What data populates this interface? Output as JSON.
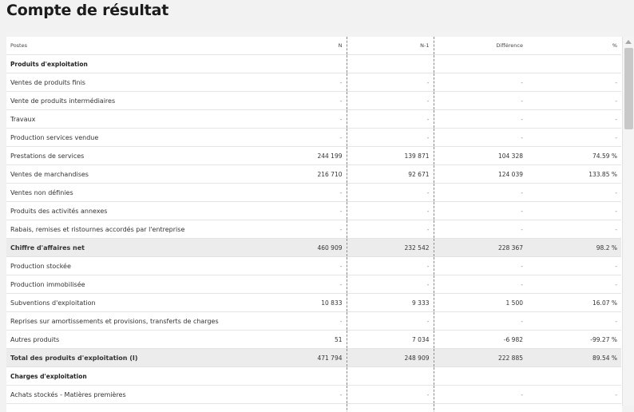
{
  "page": {
    "title": "Compte de résultat"
  },
  "table": {
    "headers": {
      "label": "Postes",
      "n": "N",
      "n1": "N-1",
      "diff": "Différence",
      "pct": "%"
    },
    "rows": [
      {
        "kind": "section",
        "label": "Produits d'exploitation",
        "n": "",
        "n1": "",
        "diff": "",
        "pct": ""
      },
      {
        "kind": "data",
        "label": "Ventes de produits finis",
        "n": "-",
        "n1": "-",
        "diff": "-",
        "pct": "-"
      },
      {
        "kind": "data",
        "label": "Vente de produits intermédiaires",
        "n": "-",
        "n1": "-",
        "diff": "-",
        "pct": "-"
      },
      {
        "kind": "data",
        "label": "Travaux",
        "n": "-",
        "n1": "-",
        "diff": "-",
        "pct": "-"
      },
      {
        "kind": "data",
        "label": "Production services vendue",
        "n": "-",
        "n1": "-",
        "diff": "-",
        "pct": "-"
      },
      {
        "kind": "data",
        "label": "Prestations de services",
        "n": "244 199",
        "n1": "139 871",
        "diff": "104 328",
        "pct": "74.59 %"
      },
      {
        "kind": "data",
        "label": "Ventes de marchandises",
        "n": "216 710",
        "n1": "92 671",
        "diff": "124 039",
        "pct": "133.85 %"
      },
      {
        "kind": "data",
        "label": "Ventes non définies",
        "n": "-",
        "n1": "-",
        "diff": "-",
        "pct": "-"
      },
      {
        "kind": "data",
        "label": "Produits des activités annexes",
        "n": "-",
        "n1": "-",
        "diff": "-",
        "pct": "-"
      },
      {
        "kind": "data",
        "label": "Rabais, remises et ristournes accordés par l'entreprise",
        "n": "-",
        "n1": "-",
        "diff": "-",
        "pct": "-"
      },
      {
        "kind": "total",
        "label": "Chiffre d'affaires net",
        "n": "460 909",
        "n1": "232 542",
        "diff": "228 367",
        "pct": "98.2 %"
      },
      {
        "kind": "data",
        "label": "Production stockée",
        "n": "-",
        "n1": "-",
        "diff": "-",
        "pct": "-"
      },
      {
        "kind": "data",
        "label": "Production immobilisée",
        "n": "-",
        "n1": "-",
        "diff": "-",
        "pct": "-"
      },
      {
        "kind": "data",
        "label": "Subventions d'exploitation",
        "n": "10 833",
        "n1": "9 333",
        "diff": "1 500",
        "pct": "16.07 %"
      },
      {
        "kind": "data",
        "label": "Reprises sur amortissements et provisions, transferts de charges",
        "n": "-",
        "n1": "-",
        "diff": "-",
        "pct": "-"
      },
      {
        "kind": "data",
        "label": "Autres produits",
        "n": "51",
        "n1": "7 034",
        "diff": "-6 982",
        "pct": "-99.27 %"
      },
      {
        "kind": "total",
        "label": "Total des produits d'exploitation (I)",
        "n": "471 794",
        "n1": "248 909",
        "diff": "222 885",
        "pct": "89.54 %"
      },
      {
        "kind": "section",
        "label": "Charges d'exploitation",
        "n": "",
        "n1": "",
        "diff": "",
        "pct": ""
      },
      {
        "kind": "data",
        "label": "Achats stockés - Matières premières",
        "n": "-",
        "n1": "-",
        "diff": "-",
        "pct": "-"
      },
      {
        "kind": "data",
        "label": "",
        "n": "",
        "n1": "",
        "diff": "",
        "pct": ""
      }
    ]
  }
}
